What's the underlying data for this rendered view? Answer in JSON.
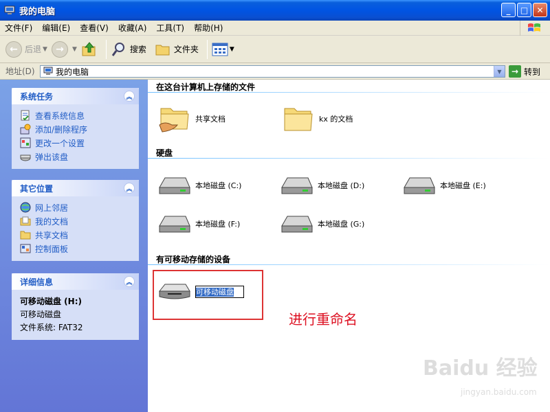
{
  "window": {
    "title": "我的电脑"
  },
  "menu": [
    "文件(F)",
    "编辑(E)",
    "查看(V)",
    "收藏(A)",
    "工具(T)",
    "帮助(H)"
  ],
  "toolbar": {
    "back": "后退",
    "search": "搜索",
    "folders": "文件夹"
  },
  "address": {
    "label": "地址(D)",
    "value": "我的电脑",
    "go": "转到"
  },
  "left": {
    "system_tasks": {
      "title": "系统任务",
      "items": [
        "查看系统信息",
        "添加/删除程序",
        "更改一个设置",
        "弹出该盘"
      ]
    },
    "other_places": {
      "title": "其它位置",
      "items": [
        "网上邻居",
        "我的文档",
        "共享文档",
        "控制面板"
      ]
    },
    "details": {
      "title": "详细信息",
      "name": "可移动磁盘 (H:)",
      "type": "可移动磁盘",
      "fs": "文件系统: FAT32"
    }
  },
  "groups": {
    "files": {
      "title": "在这台计算机上存储的文件",
      "items": [
        "共享文档",
        "kx 的文档"
      ]
    },
    "hdd": {
      "title": "硬盘",
      "items": [
        "本地磁盘 (C:)",
        "本地磁盘 (D:)",
        "本地磁盘 (E:)",
        "本地磁盘 (F:)",
        "本地磁盘 (G:)"
      ]
    },
    "removable": {
      "title": "有可移动存储的设备",
      "rename_value": "可移动磁盘"
    }
  },
  "annotation": "进行重命名",
  "watermark": {
    "main": "Baidu 经验",
    "sub": "jingyan.baidu.com"
  }
}
